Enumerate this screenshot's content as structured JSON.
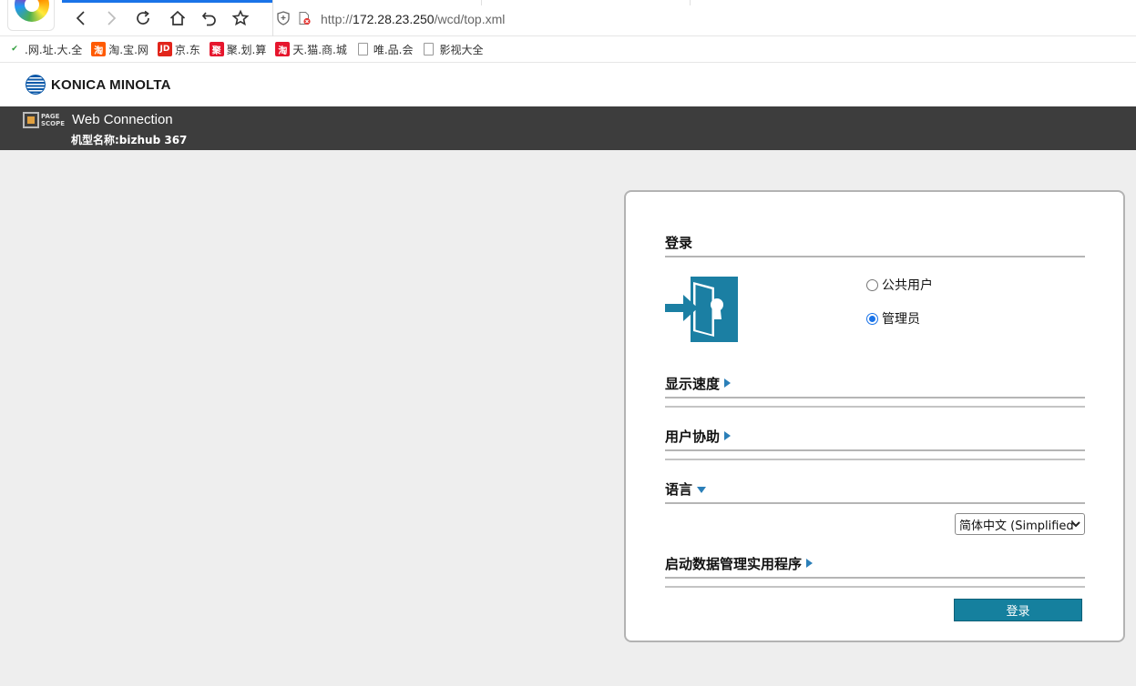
{
  "browser": {
    "url_scheme": "http://",
    "url_host": "172.28.23.250",
    "url_path": "/wcd/top.xml"
  },
  "bookmarks": [
    {
      "label": ".网.址.大.全",
      "icon": "hao-icon"
    },
    {
      "label": "淘.宝.网",
      "icon": "taobao-icon"
    },
    {
      "label": "京.东",
      "icon": "jd-icon"
    },
    {
      "label": "聚.划.算",
      "icon": "juhuasuan-icon"
    },
    {
      "label": "天.猫.商.城",
      "icon": "tmall-icon"
    },
    {
      "label": "唯.品.会",
      "icon": "page-icon"
    },
    {
      "label": "影视大全",
      "icon": "page-icon"
    }
  ],
  "site": {
    "brand": "KONICA MINOLTA",
    "ps_line1": "PAGE",
    "ps_line2": "SCOPE",
    "app_title": "Web Connection",
    "model_label": "机型名称:bizhub 367"
  },
  "login": {
    "title": "登录",
    "options": [
      {
        "label": "公共用户",
        "checked": false
      },
      {
        "label": "管理员",
        "checked": true
      }
    ],
    "display_speed": "显示速度",
    "user_assist": "用户协助",
    "language": "语言",
    "language_value": "简体中文 (Simplified",
    "data_util": "启动数据管理实用程序",
    "button": "登录"
  },
  "colors": {
    "accent": "#15809e",
    "door": "#1b7fa3",
    "header_bar": "#3d3d3d",
    "tab_indicator": "#1a73e8"
  }
}
